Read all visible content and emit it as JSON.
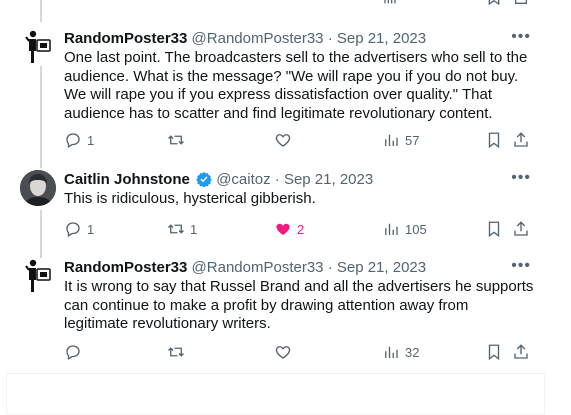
{
  "tweets": [
    {
      "name": "RandomPoster33",
      "handle": "@RandomPoster33",
      "date": "Sep 21, 2023",
      "text": "One last point. The broadcasters sell to the advertisers who sell to the audience. What is the message? \"We will rape you if you do not buy. We will rape you if you express dissatisfaction over quality.\" That audience has to scatter and find legitimate revolutionary content.",
      "replies": "1",
      "retweets": "",
      "likes": "",
      "views": "57"
    },
    {
      "name": "Caitlin Johnstone",
      "handle": "@caitoz",
      "date": "Sep 21, 2023",
      "text": "This is ridiculous, hysterical gibberish.",
      "replies": "1",
      "retweets": "1",
      "likes": "2",
      "views": "105"
    },
    {
      "name": "RandomPoster33",
      "handle": "@RandomPoster33",
      "date": "Sep 21, 2023",
      "text": "It is wrong to say that Russel Brand and all the advertisers he supports can continue to make a profit by drawing attention away from legitimate revolutionary writers.",
      "replies": "",
      "retweets": "",
      "likes": "",
      "views": "32"
    }
  ],
  "separator": "·",
  "more_glyph": "•••",
  "colors": {
    "like_active": "#f91880",
    "verified": "#1d9bf0",
    "muted": "#536471"
  }
}
